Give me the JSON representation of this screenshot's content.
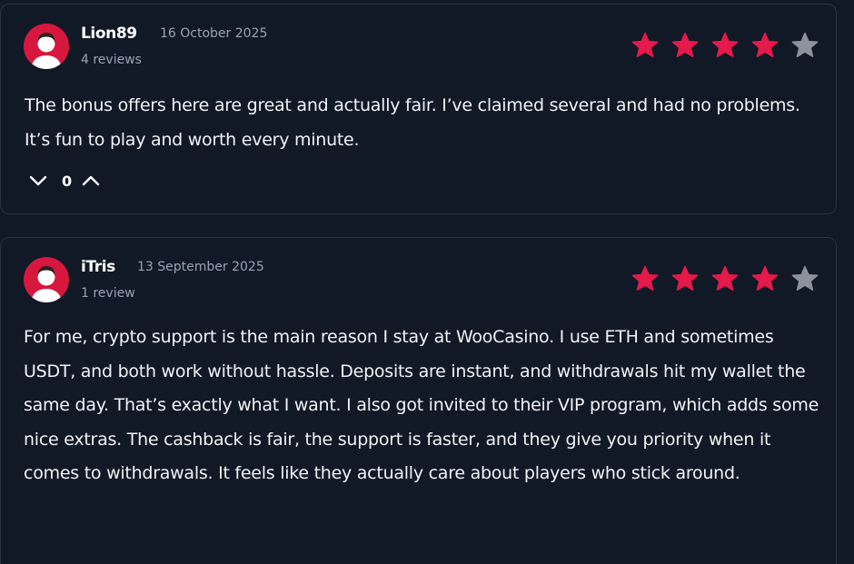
{
  "colors": {
    "background": "#111826",
    "star_filled": "#e6194b",
    "star_empty": "#8c929c",
    "muted_text": "#9aa3b3",
    "avatar_red": "#d8173e"
  },
  "reviews": [
    {
      "username": "Lion89",
      "date": "16 October 2025",
      "review_count": "4 reviews",
      "rating": 4,
      "max_rating": 5,
      "text": "The bonus offers here are great and actually fair. I’ve claimed several and had no problems. It’s fun to play and worth every minute.",
      "votes": "0",
      "icons": {
        "avatar": "user-avatar-icon",
        "downvote": "chevron-down-icon",
        "upvote": "chevron-up-icon",
        "star": "star-icon"
      }
    },
    {
      "username": "iTris",
      "date": "13 September 2025",
      "review_count": "1 review",
      "rating": 4,
      "max_rating": 5,
      "text": "For me, crypto support is the main reason I stay at WooCasino. I use ETH and sometimes USDT, and both work without hassle. Deposits are instant, and withdrawals hit my wallet the same day. That’s exactly what I want. I also got invited to their VIP program, which adds some nice extras. The cashback is fair, the support is faster, and they give you priority when it comes to withdrawals. It feels like they actually care about players who stick around."
    }
  ]
}
